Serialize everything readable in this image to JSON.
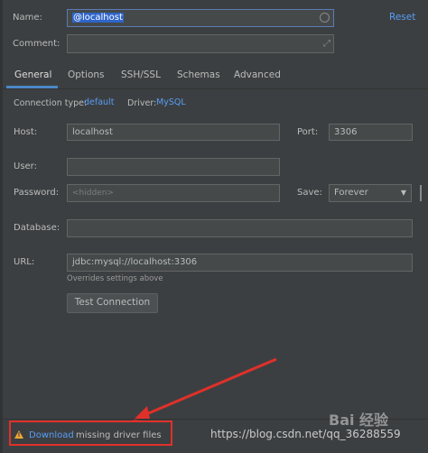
{
  "form": {
    "name_label": "Name:",
    "name_value": "@localhost",
    "reset_label": "Reset",
    "comment_label": "Comment:"
  },
  "tabs": [
    "General",
    "Options",
    "SSH/SSL",
    "Schemas",
    "Advanced"
  ],
  "general": {
    "connection_type_label": "Connection type:",
    "connection_type_value": "default",
    "driver_label": "Driver:",
    "driver_value": "MySQL",
    "host_label": "Host:",
    "host_value": "localhost",
    "port_label": "Port:",
    "port_value": "3306",
    "user_label": "User:",
    "user_value": "",
    "password_label": "Password:",
    "password_placeholder": "<hidden>",
    "save_label": "Save:",
    "save_value": "Forever",
    "database_label": "Database:",
    "database_value": "",
    "url_label": "URL:",
    "url_value": "jdbc:mysql://localhost:3306",
    "overrides_note": "Overrides settings above",
    "test_connection_label": "Test Connection"
  },
  "footer": {
    "download_link": "Download",
    "missing_text": "missing driver files"
  },
  "watermark": {
    "url": "https://blog.csdn.net/qq_36288559",
    "brand": "Bai 经验"
  },
  "colors": {
    "background": "#3c3f41",
    "field_bg": "#45494a",
    "link": "#589df6",
    "annotation_red": "#e0302a",
    "warning": "#f0a732"
  },
  "icons": {
    "warning": "warning-icon",
    "expand": "expand-icon",
    "name_circle": "circle-icon",
    "dropdown": "chevron-down-icon"
  }
}
